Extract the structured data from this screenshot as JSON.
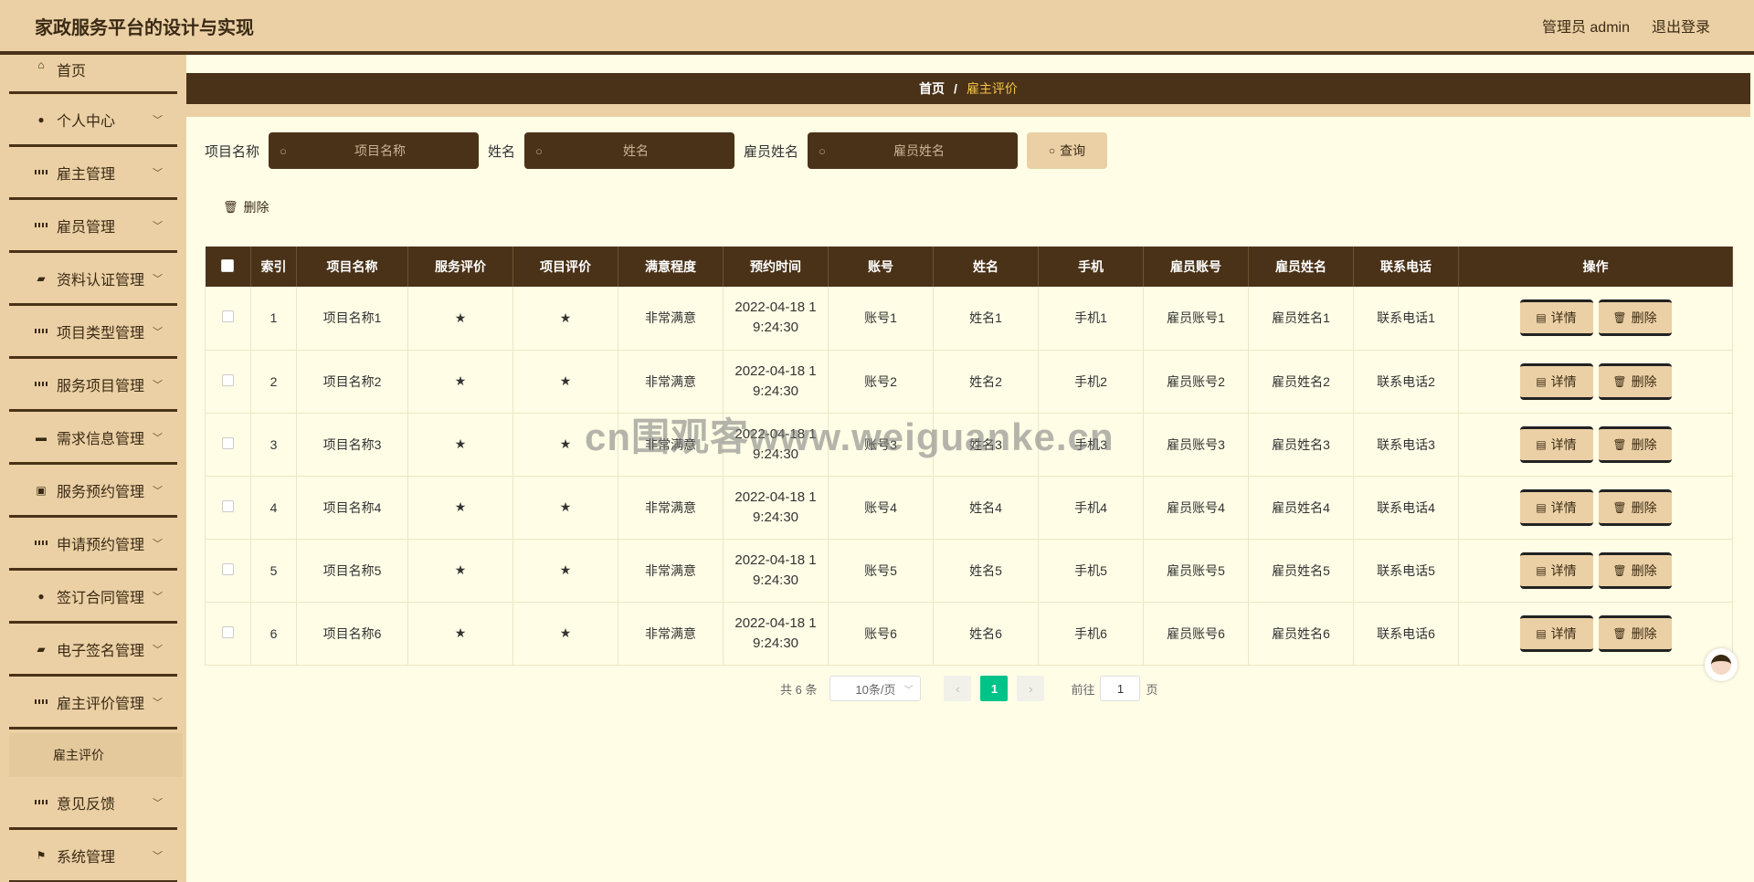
{
  "header": {
    "title": "家政服务平台的设计与实现",
    "user_label": "管理员 admin",
    "logout_label": "退出登录"
  },
  "sidebar": {
    "items": [
      {
        "label": "首页",
        "icon": "home-icon"
      },
      {
        "label": "个人中心",
        "icon": "user-icon"
      },
      {
        "label": "雇主管理",
        "icon": "grid-icon"
      },
      {
        "label": "雇员管理",
        "icon": "grid-icon"
      },
      {
        "label": "资料认证管理",
        "icon": "thumb-icon"
      },
      {
        "label": "项目类型管理",
        "icon": "grid-icon"
      },
      {
        "label": "服务项目管理",
        "icon": "grid-icon"
      },
      {
        "label": "需求信息管理",
        "icon": "monitor-icon"
      },
      {
        "label": "服务预约管理",
        "icon": "clipboard-icon"
      },
      {
        "label": "申请预约管理",
        "icon": "grid-icon"
      },
      {
        "label": "签订合同管理",
        "icon": "user-icon"
      },
      {
        "label": "电子签名管理",
        "icon": "chat-icon"
      },
      {
        "label": "雇主评价管理",
        "icon": "grid-icon"
      }
    ],
    "submenu": {
      "label": "雇主评价"
    },
    "bottom_items": [
      {
        "label": "意见反馈",
        "icon": "grid-icon"
      },
      {
        "label": "系统管理",
        "icon": "flag-icon"
      }
    ]
  },
  "breadcrumb": {
    "home": "首页",
    "separator": "/",
    "current": "雇主评价"
  },
  "search": {
    "project_label": "项目名称",
    "project_placeholder": "项目名称",
    "name_label": "姓名",
    "name_placeholder": "姓名",
    "employee_label": "雇员姓名",
    "employee_placeholder": "雇员姓名",
    "query_label": "查询"
  },
  "toolbar": {
    "delete_label": "删除"
  },
  "table": {
    "headers": [
      "索引",
      "项目名称",
      "服务评价",
      "项目评价",
      "满意程度",
      "预约时间",
      "账号",
      "姓名",
      "手机",
      "雇员账号",
      "雇员姓名",
      "联系电话",
      "操作"
    ],
    "rows": [
      {
        "index": "1",
        "project": "项目名称1",
        "service_rating": "★",
        "project_rating": "★",
        "satisfaction": "非常满意",
        "time_a": "2022-04-18 1",
        "time_b": "9:24:30",
        "account": "账号1",
        "name": "姓名1",
        "phone": "手机1",
        "emp_account": "雇员账号1",
        "emp_name": "雇员姓名1",
        "contact": "联系电话1"
      },
      {
        "index": "2",
        "project": "项目名称2",
        "service_rating": "★",
        "project_rating": "★",
        "satisfaction": "非常满意",
        "time_a": "2022-04-18 1",
        "time_b": "9:24:30",
        "account": "账号2",
        "name": "姓名2",
        "phone": "手机2",
        "emp_account": "雇员账号2",
        "emp_name": "雇员姓名2",
        "contact": "联系电话2"
      },
      {
        "index": "3",
        "project": "项目名称3",
        "service_rating": "★",
        "project_rating": "★",
        "satisfaction": "非常满意",
        "time_a": "2022-04-18 1",
        "time_b": "9:24:30",
        "account": "账号3",
        "name": "姓名3",
        "phone": "手机3",
        "emp_account": "雇员账号3",
        "emp_name": "雇员姓名3",
        "contact": "联系电话3"
      },
      {
        "index": "4",
        "project": "项目名称4",
        "service_rating": "★",
        "project_rating": "★",
        "satisfaction": "非常满意",
        "time_a": "2022-04-18 1",
        "time_b": "9:24:30",
        "account": "账号4",
        "name": "姓名4",
        "phone": "手机4",
        "emp_account": "雇员账号4",
        "emp_name": "雇员姓名4",
        "contact": "联系电话4"
      },
      {
        "index": "5",
        "project": "项目名称5",
        "service_rating": "★",
        "project_rating": "★",
        "satisfaction": "非常满意",
        "time_a": "2022-04-18 1",
        "time_b": "9:24:30",
        "account": "账号5",
        "name": "姓名5",
        "phone": "手机5",
        "emp_account": "雇员账号5",
        "emp_name": "雇员姓名5",
        "contact": "联系电话5"
      },
      {
        "index": "6",
        "project": "项目名称6",
        "service_rating": "★",
        "project_rating": "★",
        "satisfaction": "非常满意",
        "time_a": "2022-04-18 1",
        "time_b": "9:24:30",
        "account": "账号6",
        "name": "姓名6",
        "phone": "手机6",
        "emp_account": "雇员账号6",
        "emp_name": "雇员姓名6",
        "contact": "联系电话6"
      }
    ],
    "detail_label": "详情",
    "delete_label": "删除"
  },
  "pagination": {
    "total": "共 6 条",
    "page_size": "10条/页",
    "current_page": "1",
    "goto_label": "前往",
    "goto_value": "1",
    "page_suffix": "页"
  },
  "watermark": "cn围观客www.weiguanke.cn",
  "colors": {
    "primary_dark": "#4a3218",
    "accent_tan": "#ebd0a5",
    "background": "#fffde6",
    "page_active": "#00c38a",
    "crumb_active": "#f3c24a"
  }
}
